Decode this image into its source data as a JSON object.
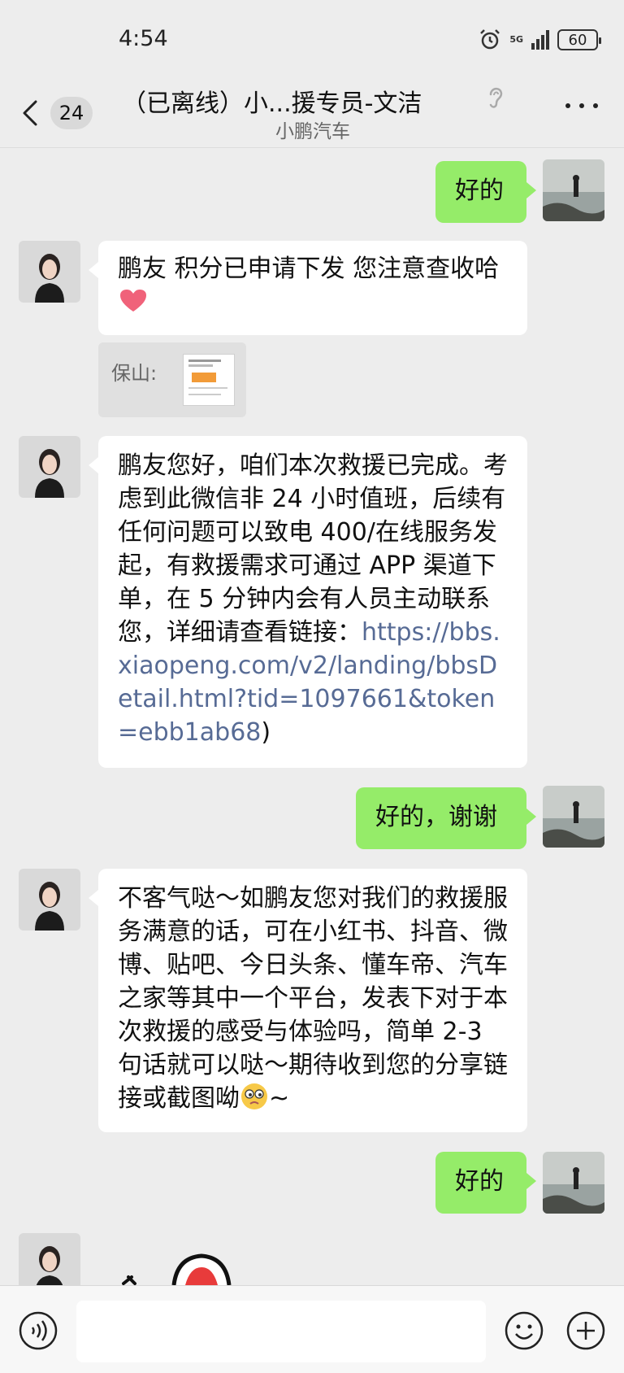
{
  "status_bar": {
    "time": "4:54",
    "network": "5G",
    "battery": "60"
  },
  "header": {
    "back_count": "24",
    "title": "（已离线）小...援专员-文洁",
    "subtitle": "小鹏汽车"
  },
  "messages": [
    {
      "side": "out",
      "text": "好的"
    },
    {
      "side": "in",
      "text": "鹏友 积分已申请下发 您注意查收哈"
    },
    {
      "side": "in",
      "quote_sender": "保山:"
    },
    {
      "side": "in",
      "text": "鹏友您好，咱们本次救援已完成。考虑到此微信非 24 小时值班，后续有任何问题可以致电 400/在线服务发起，有救援需求可通过 APP 渠道下单，在 5 分钟内会有人员主动联系您，详细请查看链接：",
      "link": "https://bbs.xiaopeng.com/v2/landing/bbsDetail.html?tid=1097661&token=ebb1ab68",
      "text_after": ")"
    },
    {
      "side": "out",
      "text": "好的，谢谢"
    },
    {
      "side": "in",
      "text": "不客气哒～如鹏友您对我们的救援服务满意的话，可在小红书、抖音、微博、贴吧、今日头条、懂车帝、汽车之家等其中一个平台，发表下对于本次救援的感受与体验吗，简单 2-3 句话就可以哒～期待收到您的分享链接或截图呦",
      "text_after": "~"
    },
    {
      "side": "out",
      "text": "好的"
    }
  ],
  "icons": {
    "alarm": "alarm-icon",
    "back": "chevron-left-icon",
    "ear": "ear-icon",
    "more": "more-dots-icon",
    "heart": "heart-icon",
    "face": "face-emoji-icon",
    "voice": "voice-icon",
    "emoji": "emoji-icon",
    "plus": "plus-icon"
  },
  "colors": {
    "background": "#ededed",
    "outgoing_bubble": "#95ec69",
    "incoming_bubble": "#ffffff",
    "link": "#576b95"
  }
}
